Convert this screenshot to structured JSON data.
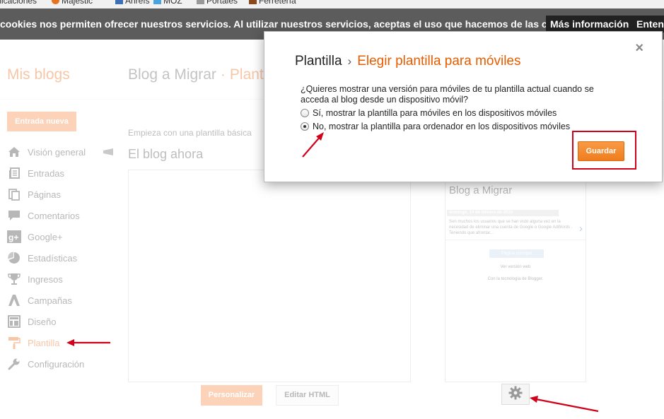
{
  "bookmarks": [
    {
      "label": "aplicaciones"
    },
    {
      "label": "Majestic"
    },
    {
      "label": "Ahrefs"
    },
    {
      "label": "MOZ"
    },
    {
      "label": "Portales"
    },
    {
      "label": "Ferretería"
    }
  ],
  "cookie_bar": {
    "text": "cookies nos permiten ofrecer nuestros servicios. Al utilizar nuestros servicios, aceptas el uso que hacemos de las cookies.",
    "more_info": "Más información",
    "accept": "Entendido"
  },
  "header": {
    "brand": "Mis blogs",
    "blog_name": "Blog a Migrar",
    "separator": "·",
    "section": "Plantilla"
  },
  "sidebar": {
    "new_post": "Entrada nueva",
    "items": [
      {
        "label": "Visión general",
        "icon": "home-icon"
      },
      {
        "label": "Entradas",
        "icon": "posts-icon"
      },
      {
        "label": "Páginas",
        "icon": "pages-icon"
      },
      {
        "label": "Comentarios",
        "icon": "comments-icon"
      },
      {
        "label": "Google+",
        "icon": "google-plus-icon"
      },
      {
        "label": "Estadísticas",
        "icon": "stats-icon"
      },
      {
        "label": "Ingresos",
        "icon": "trophy-icon"
      },
      {
        "label": "Campañas",
        "icon": "campaigns-icon"
      },
      {
        "label": "Diseño",
        "icon": "layout-icon"
      },
      {
        "label": "Plantilla",
        "icon": "paint-roller-icon",
        "active": true
      },
      {
        "label": "Configuración",
        "icon": "wrench-icon"
      }
    ]
  },
  "main": {
    "intro": "Empieza con una plantilla básica",
    "current_label": "El blog ahora",
    "customize": "Personalizar",
    "edit_html": "Editar HTML",
    "mobile_preview": {
      "title": "Blog a Migrar",
      "date": "domingo, 14 de febrero de 2016",
      "excerpt": "Son muchos los usuarios que se han visto alguna vez en la necesidad de eliminar una cuenta de Google o Google AdWords . Teniendo que afrontar...",
      "home_button": "Página principal",
      "web_version": "Ver versión web",
      "tech": "Con la tecnología de Blogger."
    }
  },
  "modal": {
    "crumb": "Plantilla",
    "arrow": "›",
    "current": "Elegir plantilla para móviles",
    "question": "¿Quieres mostrar una versión para móviles de tu plantilla actual cuando se acceda al blog desde un dispositivo móvil?",
    "options": [
      {
        "label": "Sí, mostrar la plantilla para móviles en los dispositivos móviles",
        "checked": false
      },
      {
        "label": "No, mostrar la plantilla para ordenador en los dispositivos móviles",
        "checked": true
      }
    ],
    "save": "Guardar",
    "close": "×"
  },
  "colors": {
    "accent": "#e65c00",
    "button_orange": "#f57f36",
    "cookie_bar": "#5c5c5c",
    "annotation_red": "#d0021b"
  }
}
